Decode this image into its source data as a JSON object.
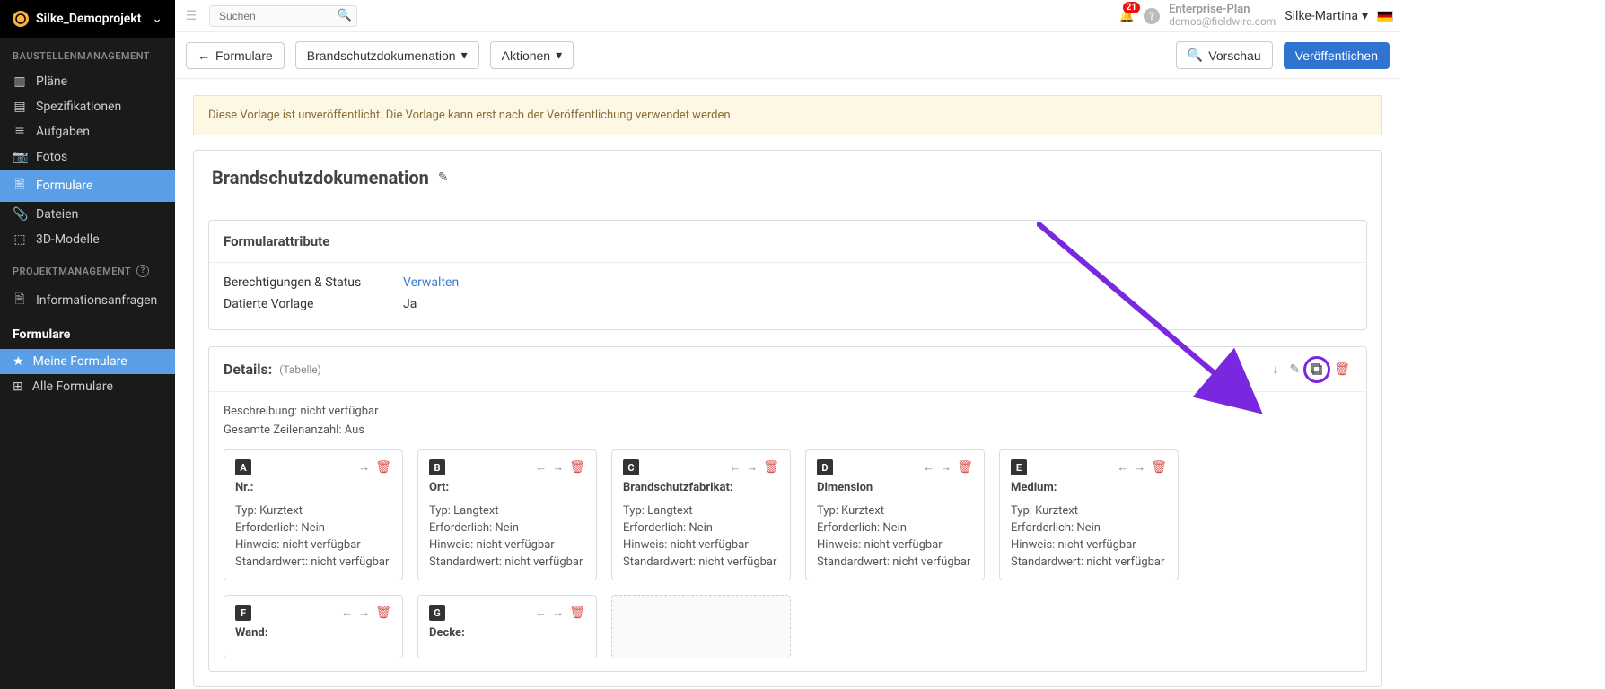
{
  "project": {
    "name": "Silke_Demoprojekt"
  },
  "sidebar": {
    "section1_label": "BAUSTELLENMANAGEMENT",
    "items1": [
      {
        "label": "Pläne",
        "icon": "▥"
      },
      {
        "label": "Spezifikationen",
        "icon": "▤"
      },
      {
        "label": "Aufgaben",
        "icon": "≣"
      },
      {
        "label": "Fotos",
        "icon": "📷"
      },
      {
        "label": "Formulare",
        "icon": "🗎",
        "active": true
      },
      {
        "label": "Dateien",
        "icon": "📎"
      },
      {
        "label": "3D-Modelle",
        "icon": "⬚"
      }
    ],
    "section2_label": "PROJEKTMANAGEMENT",
    "items2": [
      {
        "label": "Informationsanfragen",
        "icon": "🗎"
      }
    ],
    "forms_header": "Formulare",
    "forms_items": [
      {
        "label": "Meine Formulare",
        "icon": "★",
        "active": true
      },
      {
        "label": "Alle Formulare",
        "icon": "⊞"
      }
    ]
  },
  "topbar": {
    "search_placeholder": "Suchen",
    "notifications": "21",
    "plan_name": "Enterprise-Plan",
    "plan_email": "demos@fieldwire.com",
    "user_name": "Silke-Martina"
  },
  "toolbar": {
    "back_label": "Formulare",
    "template_name": "Brandschutzdokumenation",
    "actions_label": "Aktionen",
    "preview_label": "Vorschau",
    "publish_label": "Veröffentlichen"
  },
  "banner": {
    "text": "Diese Vorlage ist unveröffentlicht. Die Vorlage kann erst nach der Veröffentlichung verwendet werden."
  },
  "form": {
    "title": "Brandschutzdokumenation",
    "attributes_title": "Formularattribute",
    "rows": [
      {
        "key": "Berechtigungen & Status",
        "value": "Verwalten",
        "link": true
      },
      {
        "key": "Datierte Vorlage",
        "value": "Ja"
      }
    ]
  },
  "section": {
    "title": "Details:",
    "subtype": "(Tabelle)",
    "desc_label": "Beschreibung: nicht verfügbar",
    "rowcount_label": "Gesamte Zeilenanzahl: Aus",
    "columns": [
      {
        "letter": "A",
        "name": "Nr.:",
        "type": "Typ: Kurztext",
        "req": "Erforderlich: Nein",
        "hint": "Hinweis: nicht verfügbar",
        "def": "Standardwert: nicht verfügbar",
        "left": false,
        "right": true
      },
      {
        "letter": "B",
        "name": "Ort:",
        "type": "Typ: Langtext",
        "req": "Erforderlich: Nein",
        "hint": "Hinweis: nicht verfügbar",
        "def": "Standardwert: nicht verfügbar",
        "left": true,
        "right": true
      },
      {
        "letter": "C",
        "name": "Brandschutzfabrikat:",
        "type": "Typ: Langtext",
        "req": "Erforderlich: Nein",
        "hint": "Hinweis: nicht verfügbar",
        "def": "Standardwert: nicht verfügbar",
        "left": true,
        "right": true
      },
      {
        "letter": "D",
        "name": "Dimension",
        "type": "Typ: Kurztext",
        "req": "Erforderlich: Nein",
        "hint": "Hinweis: nicht verfügbar",
        "def": "Standardwert: nicht verfügbar",
        "left": true,
        "right": true
      },
      {
        "letter": "E",
        "name": "Medium:",
        "type": "Typ: Kurztext",
        "req": "Erforderlich: Nein",
        "hint": "Hinweis: nicht verfügbar",
        "def": "Standardwert: nicht verfügbar",
        "left": true,
        "right": true
      },
      {
        "letter": "F",
        "name": "Wand:",
        "type": "",
        "req": "",
        "hint": "",
        "def": "",
        "left": true,
        "right": true,
        "short": true
      },
      {
        "letter": "G",
        "name": "Decke:",
        "type": "",
        "req": "",
        "hint": "",
        "def": "",
        "left": true,
        "right": true,
        "short": true
      }
    ]
  }
}
